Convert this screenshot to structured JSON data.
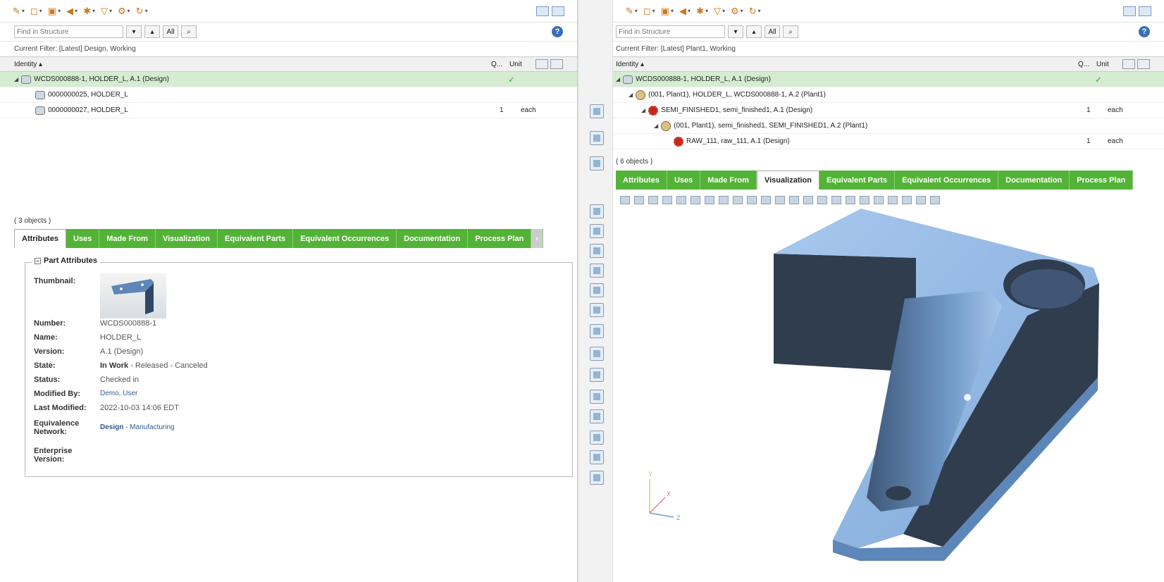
{
  "left": {
    "find_placeholder": "Find in Structure",
    "find_all": "All",
    "filter": "Current Filter: [Latest] Design, Working",
    "columns": {
      "identity": "Identity ▴",
      "q": "Q...",
      "unit": "Unit"
    },
    "rows": [
      {
        "name": "WCDS000888-1, HOLDER_L, A.1 (Design)",
        "q": "",
        "unit": ""
      },
      {
        "name": "0000000025, HOLDER_L",
        "q": "",
        "unit": ""
      },
      {
        "name": "0000000027, HOLDER_L",
        "q": "1",
        "unit": "each"
      }
    ],
    "count": "( 3 objects )",
    "tabs": [
      "Attributes",
      "Uses",
      "Made From",
      "Visualization",
      "Equivalent Parts",
      "Equivalent Occurrences",
      "Documentation",
      "Process Plan"
    ],
    "section_title": "Part Attributes",
    "attributes": {
      "thumbnail_label": "Thumbnail:",
      "number_label": "Number:",
      "number": "WCDS000888-1",
      "name_label": "Name:",
      "name": "HOLDER_L",
      "version_label": "Version:",
      "version": "A.1 (Design)",
      "state_label": "State:",
      "state_current": "In Work",
      "state_rest": " - Released - Canceled",
      "status_label": "Status:",
      "status": "Checked in",
      "modified_by_label": "Modified By:",
      "modified_by": "Demo, User",
      "last_modified_label": "Last Modified:",
      "last_modified": "2022-10-03 14:06 EDT",
      "equiv_label": "Equivalence Network:",
      "equiv_design": "Design",
      "equiv_rest": " - Manufacturing",
      "enterprise_label": "Enterprise Version:"
    }
  },
  "right": {
    "find_placeholder": "Find in Structure",
    "find_all": "All",
    "filter": "Current Filter: [Latest] Plant1, Working",
    "columns": {
      "identity": "Identity ▴",
      "q": "Q...",
      "unit": "Unit"
    },
    "rows": [
      {
        "name": "WCDS000888-1, HOLDER_L, A.1 (Design)",
        "q": "",
        "unit": ""
      },
      {
        "name": "(001, Plant1), HOLDER_L, WCDS000888-1, A.2 (Plant1)",
        "q": "",
        "unit": ""
      },
      {
        "name": "SEMI_FINISHED1, semi_finished1, A.1 (Design)",
        "q": "1",
        "unit": "each"
      },
      {
        "name": "(001, Plant1), semi_finished1, SEMI_FINISHED1, A.2 (Plant1)",
        "q": "",
        "unit": ""
      },
      {
        "name": "RAW_111, raw_111, A.1 (Design)",
        "q": "1",
        "unit": "each"
      }
    ],
    "count": "( 6 objects )",
    "tabs": [
      "Attributes",
      "Uses",
      "Made From",
      "Visualization",
      "Equivalent Parts",
      "Equivalent Occurrences",
      "Documentation",
      "Process Plan"
    ],
    "active_tab": "Visualization",
    "axes": {
      "y": "Y",
      "x": "X",
      "z": "Z"
    }
  },
  "colors": {
    "tab_green": "#53b337",
    "selected_row": "#d6ecd2",
    "model_face": "#8fb6e3",
    "model_dark": "#2f3d4f"
  }
}
